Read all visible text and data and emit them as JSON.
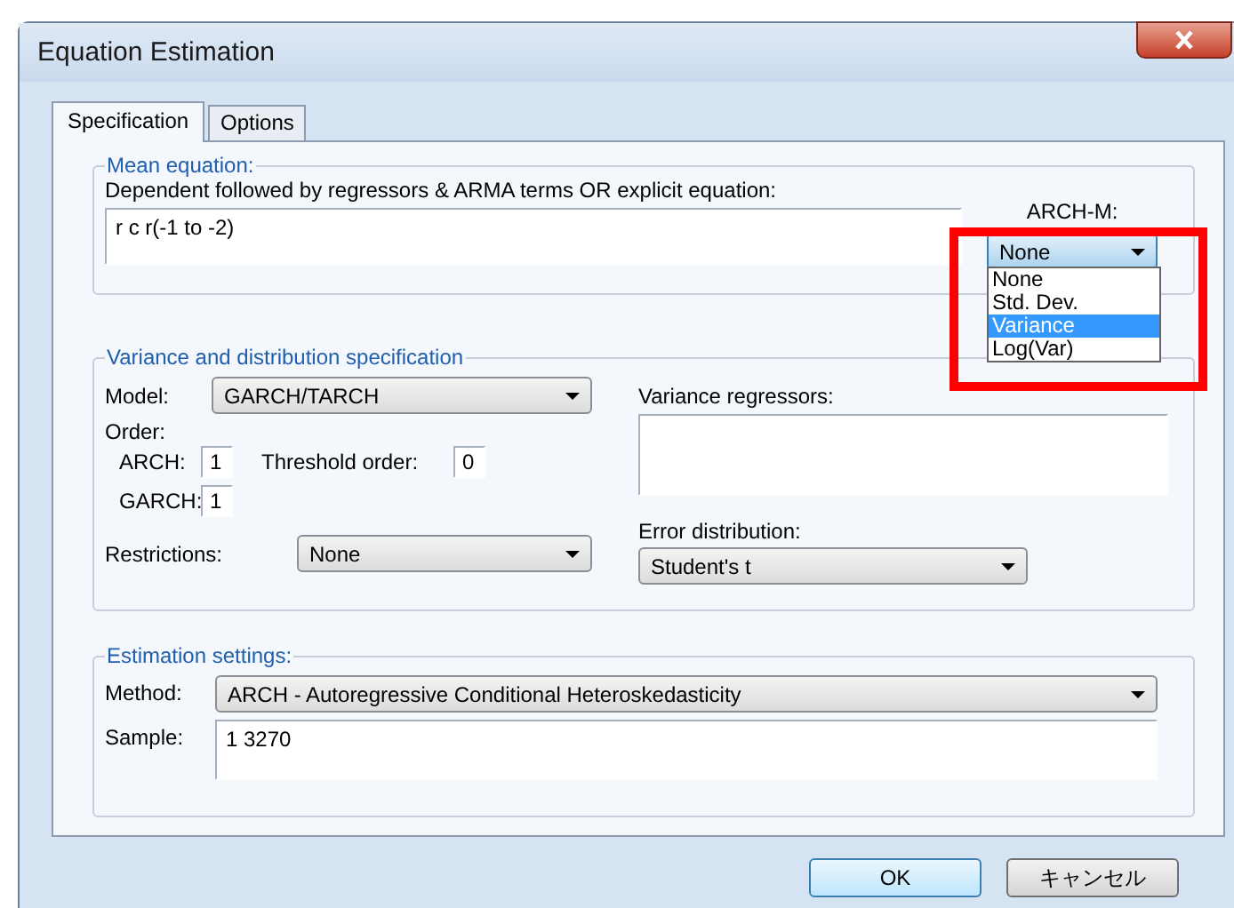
{
  "window": {
    "title": "Equation Estimation"
  },
  "tabs": [
    {
      "label": "Specification",
      "selected": true
    },
    {
      "label": "Options",
      "selected": false
    }
  ],
  "mean_equation": {
    "title": "Mean equation:",
    "prompt": "Dependent followed by regressors & ARMA terms OR explicit equation:",
    "value": "r c r(-1 to -2)",
    "arch_m": {
      "label": "ARCH-M:",
      "value": "None",
      "expanded": true,
      "options": [
        {
          "label": "None",
          "highlighted": false
        },
        {
          "label": "Std. Dev.",
          "highlighted": false
        },
        {
          "label": "Variance",
          "highlighted": true
        },
        {
          "label": "Log(Var)",
          "highlighted": false
        }
      ]
    }
  },
  "variance": {
    "title": "Variance and distribution specification",
    "model": {
      "label": "Model:",
      "value": "GARCH/TARCH"
    },
    "order_label": "Order:",
    "arch": {
      "label": "ARCH:",
      "value": "1"
    },
    "threshold": {
      "label": "Threshold order:",
      "value": "0"
    },
    "garch": {
      "label": "GARCH:",
      "value": "1"
    },
    "restrictions": {
      "label": "Restrictions:",
      "value": "None"
    },
    "regressors": {
      "label": "Variance regressors:"
    },
    "error_distribution": {
      "label": "Error distribution:",
      "value": "Student's t"
    }
  },
  "estimation": {
    "title": "Estimation settings:",
    "method": {
      "label": "Method:",
      "value": "ARCH  -  Autoregressive Conditional Heteroskedasticity"
    },
    "sample": {
      "label": "Sample:",
      "value": "1 3270"
    }
  },
  "buttons": [
    {
      "label": "OK",
      "kind": "default"
    },
    {
      "label": "キャンセル",
      "kind": "normal"
    }
  ]
}
